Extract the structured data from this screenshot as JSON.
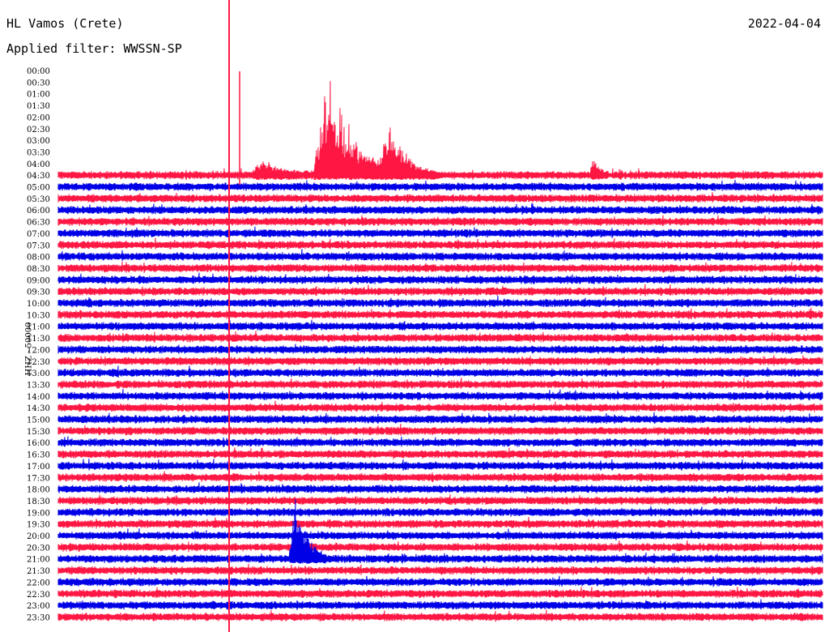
{
  "header": {
    "station": "HL Vamos (Crete)",
    "date": "2022-04-04",
    "filter": "Applied filter: WWSSN-SP"
  },
  "chart_data": {
    "type": "line",
    "subtype": "helicorder",
    "ylabel": "HHZ - 50000",
    "row_labels": [
      "00:00",
      "00:30",
      "01:00",
      "01:30",
      "02:00",
      "02:30",
      "03:00",
      "03:30",
      "04:00",
      "04:30",
      "05:00",
      "05:30",
      "06:00",
      "06:30",
      "07:00",
      "07:30",
      "08:00",
      "08:30",
      "09:00",
      "09:30",
      "10:00",
      "10:30",
      "11:00",
      "11:30",
      "12:00",
      "12:30",
      "13:00",
      "13:30",
      "14:00",
      "14:30",
      "15:00",
      "15:30",
      "16:00",
      "16:30",
      "17:00",
      "17:30",
      "18:00",
      "18:30",
      "19:00",
      "19:30",
      "20:00",
      "20:30",
      "21:00",
      "21:30",
      "22:00",
      "22:30",
      "23:00",
      "23:30"
    ],
    "first_trace_row": "04:30",
    "series_colors": [
      "#ff1744",
      "#0000e6"
    ],
    "marker_color": "#ff1744",
    "events": [
      {
        "row": "04:30",
        "minute": 10.6,
        "peak": 9.8,
        "duration_min": 3.0
      },
      {
        "row": "04:30",
        "minute": 13.0,
        "peak": 4.8,
        "duration_min": 1.8
      },
      {
        "row": "04:30",
        "minute": 8.0,
        "peak": 1.3,
        "duration_min": 2.0
      },
      {
        "row": "04:30",
        "minute": 21.0,
        "peak": 1.6,
        "duration_min": 0.6
      },
      {
        "row": "21:00",
        "minute": 9.3,
        "peak": 6.0,
        "duration_min": 1.2
      }
    ]
  },
  "legend": {
    "trace_even_color": "#ff1744",
    "trace_odd_color": "#0000e6"
  }
}
